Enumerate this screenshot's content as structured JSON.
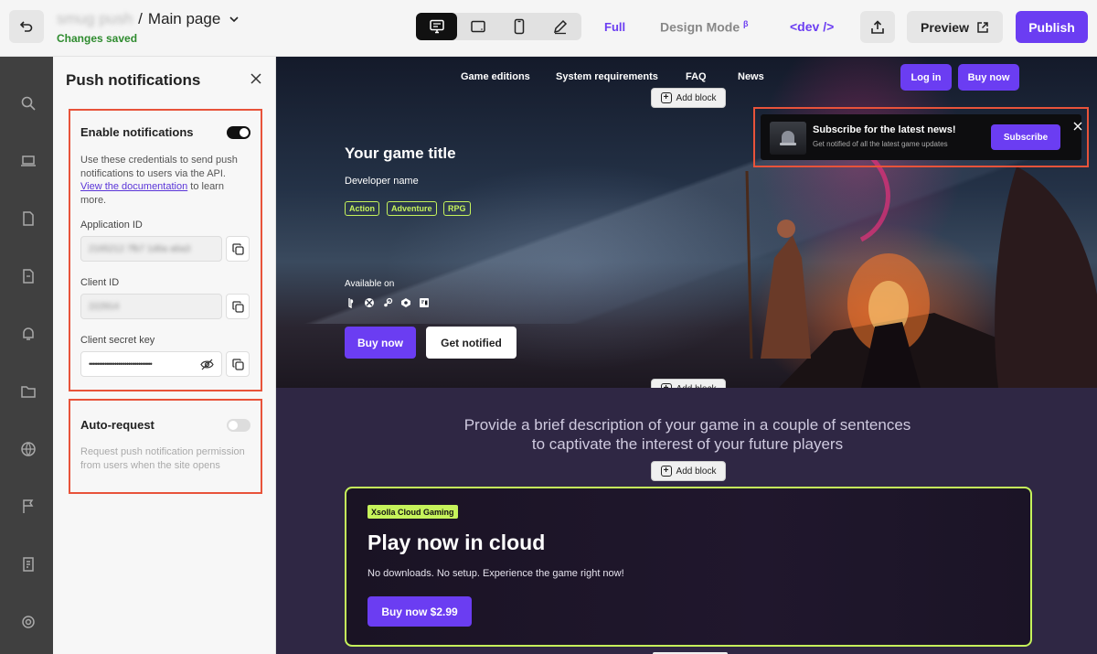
{
  "header": {
    "project_name": "smug push",
    "separator": "/",
    "page_name": "Main page",
    "status": "Changes saved",
    "view_modes": [
      {
        "icon": "desktop-icon",
        "active": true
      },
      {
        "icon": "tablet-landscape-icon",
        "active": false
      },
      {
        "icon": "mobile-icon",
        "active": false
      },
      {
        "icon": "pen-icon",
        "active": false
      }
    ],
    "full_label": "Full",
    "design_mode_label": "Design Mode",
    "design_mode_sup": "β",
    "dev_label": "<dev />",
    "preview_label": "Preview",
    "publish_label": "Publish"
  },
  "panel": {
    "title": "Push notifications",
    "enable": {
      "title": "Enable notifications",
      "enabled": true,
      "desc_before": "Use these credentials to send push notifications to users via the API. ",
      "desc_link": "View the documentation",
      "desc_after": " to learn more."
    },
    "fields": [
      {
        "label": "Application ID",
        "value": "2165212 7fb7 1d6a a6a3"
      },
      {
        "label": "Client ID",
        "value": "222914"
      },
      {
        "label": "Client secret key",
        "value": "••••••••••••••••••••••••••••••••"
      }
    ],
    "auto": {
      "title": "Auto-request",
      "enabled": false,
      "desc": "Request push notification permission from users when the site opens"
    }
  },
  "site": {
    "nav": [
      "Game editions",
      "System requirements",
      "FAQ",
      "News"
    ],
    "login": "Log in",
    "buy_now": "Buy now",
    "add_block": "Add block",
    "subscribe": {
      "title": "Subscribe for the latest news!",
      "text": "Get notified of all the latest game updates",
      "button": "Subscribe"
    },
    "game_title": "Your game title",
    "developer": "Developer name",
    "tags": [
      "Action",
      "Adventure",
      "RPG"
    ],
    "available_on": "Available on",
    "platforms": [
      "playstation-icon",
      "xbox-icon",
      "steam-icon",
      "epic-icon",
      "gog-icon"
    ],
    "hero_buy": "Buy now",
    "hero_notify": "Get notified",
    "description": "Provide a brief description of your game in a couple of sentences to captivate the interest of your future players",
    "cloud": {
      "badge": "Xsolla Cloud Gaming",
      "title": "Play now in cloud",
      "text": "No downloads. No setup. Experience the game right now!",
      "button": "Buy now $2.99"
    }
  },
  "colors": {
    "accent": "#6b3df2",
    "highlight": "#e8533a",
    "lime": "#c6f35b"
  }
}
